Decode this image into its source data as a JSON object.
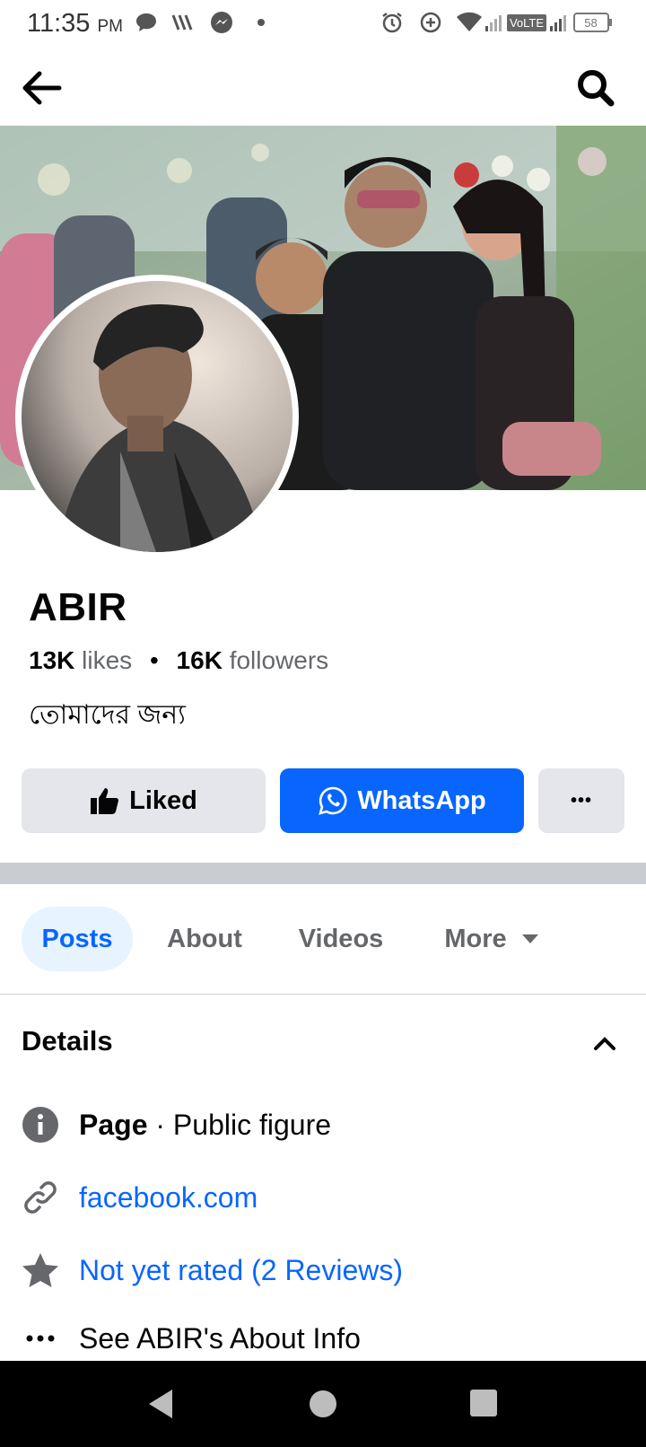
{
  "status_bar": {
    "time": "11:35",
    "ampm": "PM",
    "network": "VoLTE",
    "battery": "58",
    "icons": [
      "chat-bubble-icon",
      "wifi-call-icon",
      "messenger-icon",
      "dot-icon",
      "alarm-icon",
      "data-saver-icon",
      "wifi-icon",
      "signal-icon",
      "battery-icon"
    ]
  },
  "header": {
    "back_icon": "arrow-left-icon",
    "search_icon": "search-icon"
  },
  "profile": {
    "name": "ABIR",
    "likes_count": "13K",
    "likes_label": "likes",
    "separator": "•",
    "followers_count": "16K",
    "followers_label": "followers",
    "bio": "তোমাদের জন্য"
  },
  "actions": {
    "liked_label": "Liked",
    "whatsapp_label": "WhatsApp",
    "more_label": "•••"
  },
  "tabs": [
    {
      "label": "Posts",
      "active": true
    },
    {
      "label": "About",
      "active": false
    },
    {
      "label": "Videos",
      "active": false
    },
    {
      "label": "More",
      "active": false
    }
  ],
  "details": {
    "title": "Details",
    "page_label": "Page",
    "page_type": " · Public figure",
    "website": "facebook.com",
    "rating": "Not yet rated (2 Reviews)",
    "see_about": "See ABIR's About Info"
  },
  "colors": {
    "accent": "#0866ff",
    "button_grey": "#e4e6eb",
    "tab_active_bg": "#e7f3ff",
    "secondary_text": "#65676b"
  }
}
